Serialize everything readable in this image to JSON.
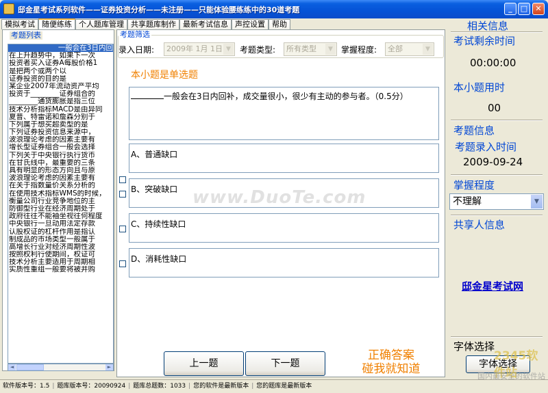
{
  "window": {
    "title": "邸金星考试系列软件——证券投资分析——未注册——只能体验腰练练中的30道考题",
    "buttons": {
      "minimize": "_",
      "maximize": "□",
      "close": "✕"
    }
  },
  "tabs": [
    "模拟考试",
    "随便练练",
    "个人题库管理",
    "共享题库制作",
    "最新考试信息",
    "声控设置",
    "帮助"
  ],
  "active_tab": "随便练练",
  "left": {
    "group_label": "考题列表",
    "items": [
      "一般会在3日内回",
      "在上升趋势中，如果下一次",
      "投资者买入证券A每股价格1",
      "是把两个或两个以",
      "证券投资的目的是",
      "某企业2007年流动资产平均",
      "投资于________证券组合的",
      "________通货膨胀是指三位",
      "技术分析指标MACD是由异同",
      "夏普、特雷诺和詹森分别于",
      "下列属于想买超卖型的是",
      "下列证券投资信息来源中，",
      "波浪理论考虑的因素主要有",
      "增长型证券组合一般会选择",
      "下列关于中央银行执行货币",
      "在甘氏线中，最重要的三条",
      "具有明显的形态方向且与原",
      "波浪理论考虑的因素主要有",
      "在关于指数量价关系分析的",
      "在使用技术指标WMS的时候，",
      "衡量公司行业竞争地位的主",
      "防御型行业在经济周期处于",
      "政府往往不能袖坐视往何程度",
      "中央银行一旦动用法定存款",
      "认股权证的杠杆作用是指认",
      "制成品的市场类型一般属于",
      "高增长行业对经济周期性波",
      "按照权利行使期间，权证可",
      "技术分析主要适用于周期相",
      "实质性重组一般要将被并购"
    ],
    "scroll_left": "◄",
    "scroll_right": "►"
  },
  "filter": {
    "group_label": "考题筛选",
    "date_label": "录入日期:",
    "date_value": "2009年 1月 1日",
    "type_label": "考题类型:",
    "type_value": "所有类型",
    "mastery_label": "掌握程度:",
    "mastery_value": "全部"
  },
  "question": {
    "type_text": "本小题是单选题",
    "stem": "一般会在3日内回补，成交量很小，很少有主动的参与者。（0.5分）",
    "options": [
      "A、普通缺口",
      "B、突破缺口",
      "C、持续性缺口",
      "D、消耗性缺口"
    ]
  },
  "nav": {
    "prev": "上一题",
    "next": "下一题",
    "answer_line1": "正确答案",
    "answer_line2": "碰我就知道"
  },
  "watermark": "www.DuoTe.com",
  "right": {
    "related_info": "相关信息",
    "remaining_label": "考试剩余时间",
    "remaining_value": "00:00:00",
    "used_label": "本小题用时",
    "used_value": "00",
    "question_info": "考题信息",
    "entry_time_label": "考题录入时间",
    "entry_time_value": "2009-09-24",
    "mastery_label": "掌握程度",
    "mastery_value": "不理解",
    "sharer_label": "共享人信息",
    "sharer_link": "邸金星考试网",
    "font_label": "字体选择",
    "font_button": "字体选择"
  },
  "status": {
    "version": "软件版本号：1.5",
    "bank_version": "题库版本号：20090924",
    "total": "题库总题数：1033",
    "software_latest": "您的软件是最新版本",
    "bank_latest": "您的题库是最新版本"
  },
  "corner_logo": {
    "big": "2345软件站",
    "small": "国内最安全的软件站"
  }
}
